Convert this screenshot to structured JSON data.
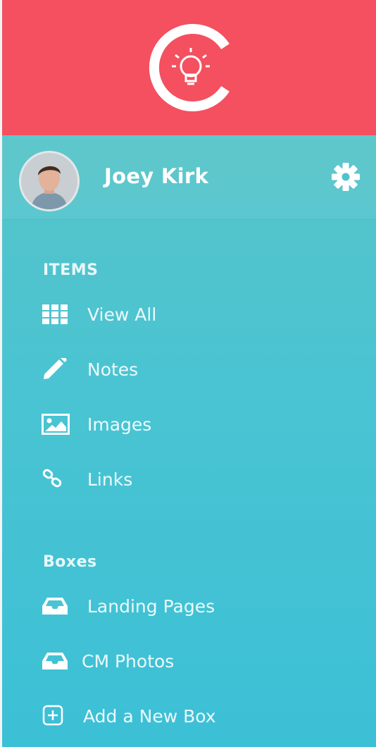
{
  "header": {
    "logo_icon": "lightbulb-c-logo-icon",
    "color": "#f4505f"
  },
  "profile": {
    "name": "Joey Kirk",
    "avatar": "avatar",
    "settings_icon": "gear-icon"
  },
  "sections": {
    "items": {
      "title": "ITEMS",
      "entries": [
        {
          "label": "View All",
          "icon": "grid-icon"
        },
        {
          "label": "Notes",
          "icon": "pencil-icon"
        },
        {
          "label": "Images",
          "icon": "image-icon"
        },
        {
          "label": "Links",
          "icon": "link-icon"
        }
      ]
    },
    "boxes": {
      "title": "Boxes",
      "entries": [
        {
          "label": "Landing Pages",
          "icon": "inbox-icon"
        },
        {
          "label": "CM Photos",
          "icon": "inbox-icon"
        },
        {
          "label": "Add a New Box",
          "icon": "plus-square-icon"
        }
      ]
    }
  },
  "colors": {
    "header": "#f4505f",
    "sidebar_top": "#57c4c9",
    "sidebar_bottom": "#3cc0d6",
    "text": "#ffffff"
  }
}
